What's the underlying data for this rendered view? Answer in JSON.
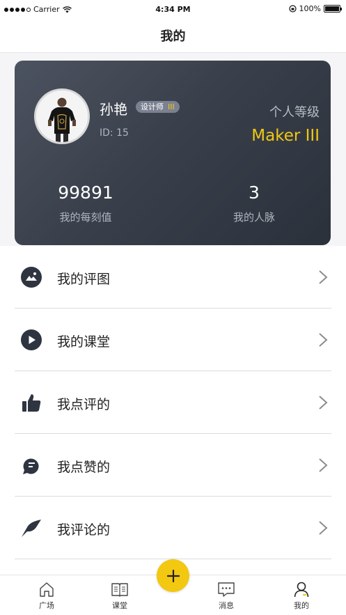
{
  "status_bar": {
    "carrier": "Carrier",
    "time": "4:34 PM",
    "battery": "100%"
  },
  "nav": {
    "title": "我的"
  },
  "profile": {
    "name": "孙艳",
    "role": "设计师",
    "role_level": "III",
    "id_text": "ID: 15",
    "level_label": "个人等级",
    "level_value": "Maker III",
    "stats": [
      {
        "value": "99891",
        "label": "我的每刻值"
      },
      {
        "value": "3",
        "label": "我的人脉"
      }
    ]
  },
  "menu": {
    "items": [
      {
        "label": "我的评图",
        "icon": "image-icon"
      },
      {
        "label": "我的课堂",
        "icon": "play-icon"
      },
      {
        "label": "我点评的",
        "icon": "thumbs-up-icon"
      },
      {
        "label": "我点赞的",
        "icon": "chat-bubble-icon"
      },
      {
        "label": "我评论的",
        "icon": "comment-arrow-icon"
      }
    ]
  },
  "tab_bar": {
    "items": [
      {
        "label": "广场",
        "icon": "home-icon"
      },
      {
        "label": "课堂",
        "icon": "book-icon"
      },
      {
        "label": "消息",
        "icon": "message-icon"
      },
      {
        "label": "我的",
        "icon": "user-icon"
      }
    ],
    "add_icon": "plus-icon"
  },
  "colors": {
    "accent": "#f2c811",
    "card_dark": "#2b313b",
    "icon_dark": "#2f3441"
  }
}
